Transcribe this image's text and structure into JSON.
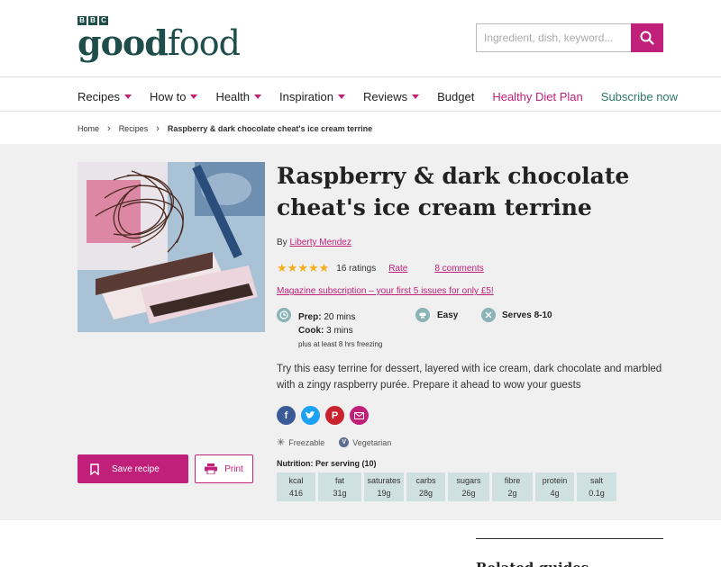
{
  "header": {
    "logo_bbc": [
      "B",
      "B",
      "C"
    ],
    "logo_bold": "good",
    "logo_light": "food",
    "search_placeholder": "Ingredient, dish, keyword...",
    "search_icon": "search-icon"
  },
  "nav": {
    "items": [
      {
        "label": "Recipes",
        "dropdown": true
      },
      {
        "label": "How to",
        "dropdown": true
      },
      {
        "label": "Health",
        "dropdown": true
      },
      {
        "label": "Inspiration",
        "dropdown": true
      },
      {
        "label": "Reviews",
        "dropdown": true
      },
      {
        "label": "Budget",
        "dropdown": false
      },
      {
        "label": "Healthy Diet Plan",
        "dropdown": false
      },
      {
        "label": "Subscribe now",
        "dropdown": false
      }
    ]
  },
  "breadcrumb": {
    "home": "Home",
    "recipes": "Recipes",
    "current": "Raspberry & dark chocolate cheat's ice cream terrine",
    "sep": "›"
  },
  "recipe": {
    "title": "Raspberry & dark chocolate cheat's ice cream terrine",
    "by": "By ",
    "author": "Liberty Mendez",
    "stars": "★★★★★",
    "ratings": "16 ratings",
    "rate": "Rate",
    "comments": "8 comments",
    "magazine": "Magazine subscription – your first 5 issues for only £5!",
    "prep_label": "Prep:",
    "prep_value": "20 mins",
    "cook_label": "Cook:",
    "cook_value": "3 mins",
    "freezing": "plus at least 8 hrs freezing",
    "difficulty": "Easy",
    "serves": "Serves 8-10",
    "description": "Try this easy terrine for dessert, layered with ice cream, dark chocolate and marbled with a zingy raspberry purée. Prepare it ahead to wow your guests",
    "tag_freezable": "Freezable",
    "tag_vegetarian": "Vegetarian",
    "save_label": "Save recipe",
    "print_label": "Print"
  },
  "nutrition": {
    "title": "Nutrition: Per serving (10)",
    "items": [
      {
        "label": "kcal",
        "value": "416"
      },
      {
        "label": "fat",
        "value": "31g"
      },
      {
        "label": "saturates",
        "value": "19g"
      },
      {
        "label": "carbs",
        "value": "28g"
      },
      {
        "label": "sugars",
        "value": "26g"
      },
      {
        "label": "fibre",
        "value": "2g"
      },
      {
        "label": "protein",
        "value": "4g"
      },
      {
        "label": "salt",
        "value": "0.1g"
      }
    ]
  },
  "related": {
    "title": "Related guides"
  },
  "colors": {
    "brand_pink": "#c0207a",
    "brand_green": "#1f4e4a",
    "nutrition_bg": "#cfe0e0",
    "star": "#f2b01e"
  }
}
